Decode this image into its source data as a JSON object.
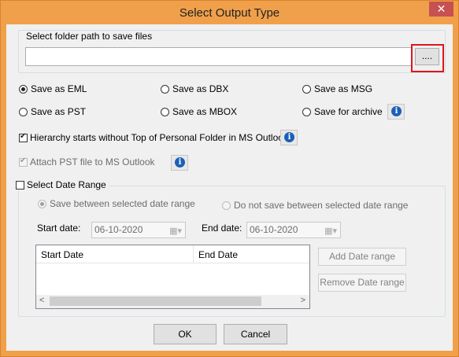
{
  "window": {
    "title": "Select Output Type",
    "close_glyph": "✕"
  },
  "folder": {
    "group_label": "Select folder path to save files",
    "path_value": "",
    "browse_label": "...."
  },
  "formats": [
    {
      "label": "Save as EML",
      "selected": true
    },
    {
      "label": "Save as DBX",
      "selected": false
    },
    {
      "label": "Save as MSG",
      "selected": false
    },
    {
      "label": "Save as PST",
      "selected": false
    },
    {
      "label": "Save as MBOX",
      "selected": false
    },
    {
      "label": "Save for archive",
      "selected": false
    }
  ],
  "options": {
    "hierarchy_label": "Hierarchy starts without Top of Personal Folder in MS Outlook",
    "hierarchy_checked": true,
    "attach_pst_label": "Attach PST file to MS Outlook",
    "attach_pst_checked": true
  },
  "date_range": {
    "checkbox_label": "Select Date Range",
    "checked": false,
    "save_between_label": "Save between selected date range",
    "not_save_between_label": "Do not save between selected date range",
    "start_label": "Start date:",
    "start_value": "06-10-2020",
    "end_label": "End date:",
    "end_value": "06-10-2020",
    "columns": [
      "Start Date",
      "End Date"
    ],
    "add_label": "Add Date range",
    "remove_label": "Remove Date range"
  },
  "buttons": {
    "ok": "OK",
    "cancel": "Cancel"
  },
  "icons": {
    "info": "info-icon",
    "calendar": "calendar-icon",
    "close": "close-icon"
  },
  "colors": {
    "titlebar": "#f0a04b",
    "close": "#c75050",
    "highlight": "#e0141e",
    "info": "#1c5fb8"
  }
}
